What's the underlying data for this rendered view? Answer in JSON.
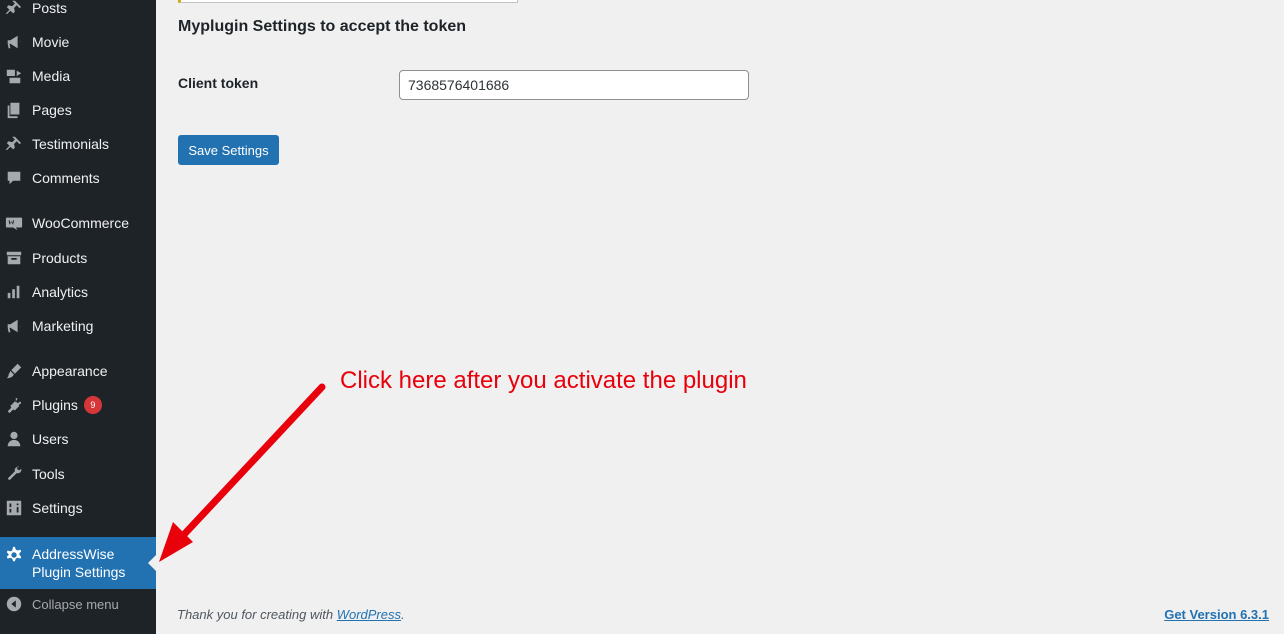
{
  "sidebar": {
    "items": [
      {
        "label": "Posts",
        "icon": "pin-icon"
      },
      {
        "label": "Movie",
        "icon": "megaphone-icon"
      },
      {
        "label": "Media",
        "icon": "media-icon"
      },
      {
        "label": "Pages",
        "icon": "pages-icon"
      },
      {
        "label": "Testimonials",
        "icon": "pin-icon"
      },
      {
        "label": "Comments",
        "icon": "comment-icon"
      },
      {
        "label": "WooCommerce",
        "icon": "woo-icon"
      },
      {
        "label": "Products",
        "icon": "archive-icon"
      },
      {
        "label": "Analytics",
        "icon": "bar-chart-icon"
      },
      {
        "label": "Marketing",
        "icon": "megaphone-icon"
      },
      {
        "label": "Appearance",
        "icon": "brush-icon"
      },
      {
        "label": "Plugins",
        "icon": "plug-icon",
        "badge": "9"
      },
      {
        "label": "Users",
        "icon": "user-icon"
      },
      {
        "label": "Tools",
        "icon": "wrench-icon"
      },
      {
        "label": "Settings",
        "icon": "sliders-icon"
      },
      {
        "label": "AddressWise Plugin Settings",
        "icon": "gear-icon",
        "current": true
      }
    ],
    "collapse_label": "Collapse menu"
  },
  "main": {
    "heading": "Myplugin Settings to accept the token",
    "token_label": "Client token",
    "token_value": "7368576401686",
    "save_label": "Save Settings"
  },
  "annotation": {
    "text": "Click here after you activate the plugin",
    "color": "#e8000b"
  },
  "footer": {
    "thanks_text": "Thank you for creating with ",
    "wordpress_link": "WordPress",
    "period": ".",
    "version_link": "Get Version 6.3.1"
  },
  "colors": {
    "sidebar_bg": "#1d2327",
    "accent": "#2271b1",
    "badge": "#d63638",
    "page_bg": "#f0f0f1"
  }
}
